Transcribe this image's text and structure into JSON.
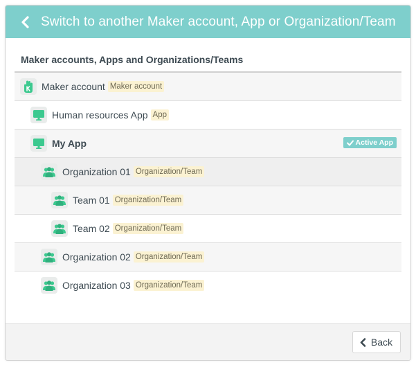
{
  "header": {
    "title": "Switch to another Maker account, App or Organization/Team"
  },
  "section_title": "Maker accounts, Apps and Organizations/Teams",
  "rows": [
    {
      "name": "Maker account",
      "badge": "Maker account",
      "icon": "maker-account-icon"
    },
    {
      "name": "Human resources App",
      "badge": "App",
      "icon": "app-icon"
    },
    {
      "name": "My App",
      "active_label": "Active App",
      "icon": "app-icon"
    },
    {
      "name": "Organization 01",
      "badge": "Organization/Team",
      "icon": "organization-icon"
    },
    {
      "name": "Team 01",
      "badge": "Organization/Team",
      "icon": "team-icon"
    },
    {
      "name": "Team 02",
      "badge": "Organization/Team",
      "icon": "team-icon"
    },
    {
      "name": "Organization 02",
      "badge": "Organization/Team",
      "icon": "organization-icon"
    },
    {
      "name": "Organization 03",
      "badge": "Organization/Team",
      "icon": "organization-icon"
    }
  ],
  "footer": {
    "back_label": "Back"
  },
  "colors": {
    "accent": "#7ecfcc",
    "icon_green": "#3cc98f",
    "badge_bg": "#fbf2d2"
  }
}
